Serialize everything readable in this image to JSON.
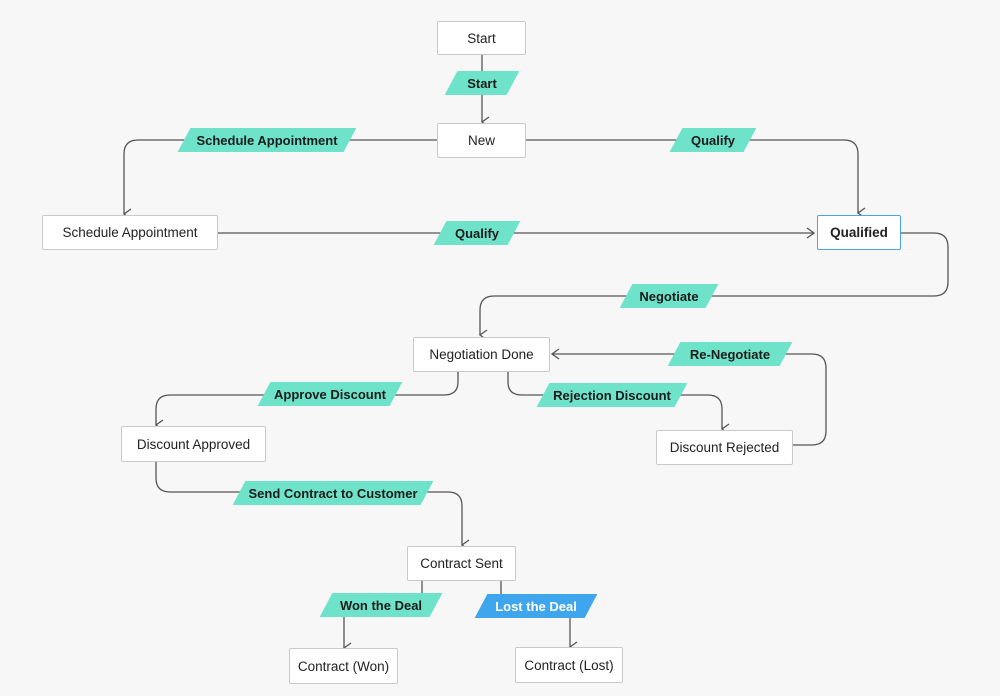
{
  "diagram": {
    "type": "blueprint-state-flow",
    "colors": {
      "background": "#f7f7f7",
      "node_border": "#c9c9c9",
      "selected_border": "#4aa3e8",
      "transition_fill": "#6fe3c9",
      "lost_transition_fill": "#3fa6ee",
      "connector": "#555555"
    },
    "states": [
      {
        "id": "start",
        "label": "Start"
      },
      {
        "id": "new",
        "label": "New"
      },
      {
        "id": "schedule",
        "label": "Schedule Appointment"
      },
      {
        "id": "qualified",
        "label": "Qualified",
        "selected": true
      },
      {
        "id": "negotiation",
        "label": "Negotiation Done"
      },
      {
        "id": "approved",
        "label": "Discount Approved"
      },
      {
        "id": "rejected",
        "label": "Discount Rejected"
      },
      {
        "id": "sent",
        "label": "Contract Sent"
      },
      {
        "id": "won",
        "label": "Contract (Won)"
      },
      {
        "id": "lost",
        "label": "Contract (Lost)"
      }
    ],
    "transitions": [
      {
        "id": "t_start",
        "label": "Start",
        "from": "start",
        "to": "new"
      },
      {
        "id": "t_schedule",
        "label": "Schedule Appointment",
        "from": "new",
        "to": "schedule"
      },
      {
        "id": "t_qualify_new",
        "label": "Qualify",
        "from": "new",
        "to": "qualified"
      },
      {
        "id": "t_qualify_sched",
        "label": "Qualify",
        "from": "schedule",
        "to": "qualified"
      },
      {
        "id": "t_negotiate",
        "label": "Negotiate",
        "from": "qualified",
        "to": "negotiation"
      },
      {
        "id": "t_renegotiate",
        "label": "Re-Negotiate",
        "from": "rejected",
        "to": "negotiation"
      },
      {
        "id": "t_approve",
        "label": "Approve Discount",
        "from": "negotiation",
        "to": "approved"
      },
      {
        "id": "t_reject",
        "label": "Rejection Discount",
        "from": "negotiation",
        "to": "rejected"
      },
      {
        "id": "t_send",
        "label": "Send Contract to Customer",
        "from": "approved",
        "to": "sent"
      },
      {
        "id": "t_won",
        "label": "Won the Deal",
        "from": "sent",
        "to": "won"
      },
      {
        "id": "t_lost",
        "label": "Lost the Deal",
        "from": "sent",
        "to": "lost",
        "highlight": true
      }
    ]
  }
}
